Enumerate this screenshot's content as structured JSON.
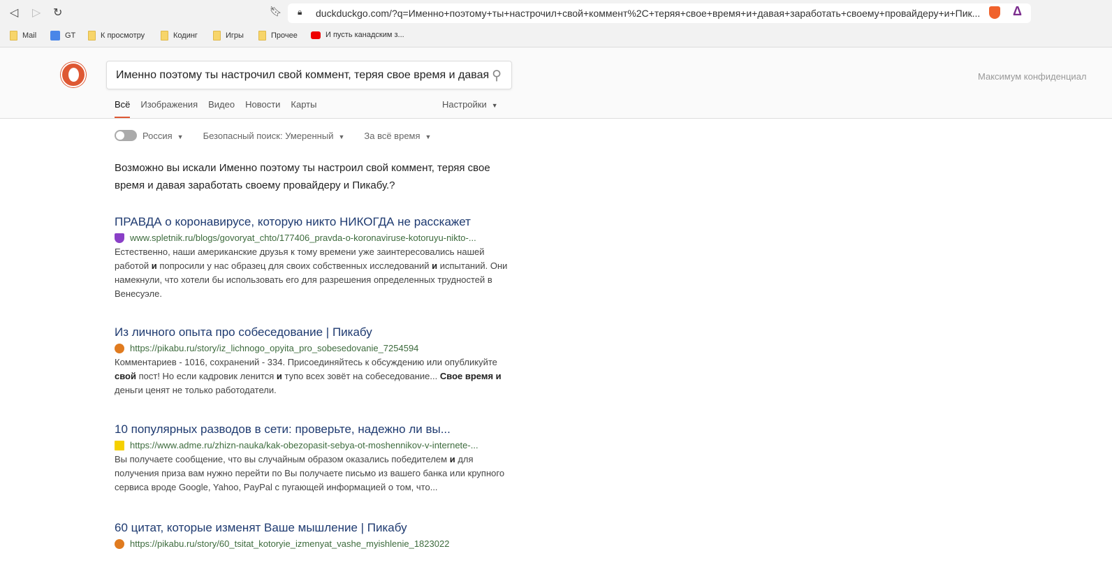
{
  "browser": {
    "url": "duckduckgo.com/?q=Именно+поэтому+ты+настрочил+свой+коммент%2C+теряя+свое+время+и+давая+заработать+своему+провайдеру+и+Пик...",
    "bookmarks": [
      {
        "label": "Mail",
        "icon": "folder"
      },
      {
        "label": "GT",
        "icon": "google-translate"
      },
      {
        "label": "К просмотру",
        "icon": "folder"
      },
      {
        "label": "Кодинг",
        "icon": "folder"
      },
      {
        "label": "Игры",
        "icon": "folder"
      },
      {
        "label": "Прочее",
        "icon": "folder"
      },
      {
        "label": "И пусть канадским з...",
        "icon": "youtube"
      }
    ]
  },
  "header": {
    "query": "Именно поэтому ты настрочил свой коммент, теряя свое время и давая",
    "privacy": "Максимум конфиденциал",
    "tabs": [
      "Всё",
      "Изображения",
      "Видео",
      "Новости",
      "Карты"
    ],
    "settings": "Настройки"
  },
  "filters": {
    "region": "Россия",
    "safe": "Безопасный поиск: Умеренный",
    "time": "За всё время"
  },
  "suggestion": "Возможно вы искали Именно поэтому ты настроил свой коммент, теряя свое время и давая заработать своему провайдеру и Пикабу.?",
  "results": [
    {
      "title": "ПРАВДА о коронавирусе, которую никто НИКОГДА не расскажет",
      "url": "www.spletnik.ru/blogs/govoryat_chto/177406_pravda-o-koronaviruse-kotoruyu-nikto-...",
      "favicon": "#8a3fc7",
      "snippet": [
        [
          "Естественно, наши американские друзья к тому времени уже заинтересовались нашей работой ",
          0
        ],
        [
          "и",
          1
        ],
        [
          " попросили у нас образец для своих собственных исследований ",
          0
        ],
        [
          "и",
          1
        ],
        [
          " испытаний. Они намекнули, что хотели бы использовать его для разрешения определенных трудностей в Венесуэле.",
          0
        ]
      ]
    },
    {
      "title": "Из личного опыта про собеседование | Пикабу",
      "url": "https://pikabu.ru/story/iz_lichnogo_opyita_pro_sobesedovanie_7254594",
      "favicon": "#e07b1f",
      "snippet": [
        [
          "Комментариев - 1016, сохранений - 334. Присоединяйтесь к обсуждению или опубликуйте ",
          0
        ],
        [
          "свой",
          1
        ],
        [
          " пост! Но если кадровик ленится ",
          0
        ],
        [
          "и",
          1
        ],
        [
          " тупо всех зовёт на собеседование... ",
          0
        ],
        [
          "Свое время и",
          1
        ],
        [
          " деньги ценят не только работодатели.",
          0
        ]
      ]
    },
    {
      "title": "10 популярных разводов в сети: проверьте, надежно ли вы...",
      "url": "https://www.adme.ru/zhizn-nauka/kak-obezopasit-sebya-ot-moshennikov-v-internete-...",
      "favicon": "#f5d000",
      "snippet": [
        [
          "Вы получаете сообщение, что вы случайным образом оказались победителем ",
          0
        ],
        [
          "и",
          1
        ],
        [
          " для получения приза вам нужно перейти по Вы получаете письмо из вашего банка или крупного сервиса вроде Google, Yahoo, PayPal с пугающей информацией о том, что...",
          0
        ]
      ]
    },
    {
      "title": "60 цитат, которые изменят Ваше мышление | Пикабу",
      "url": "https://pikabu.ru/story/60_tsitat_kotoryie_izmenyat_vashe_myishlenie_1823022",
      "favicon": "#e07b1f",
      "snippet": []
    }
  ]
}
